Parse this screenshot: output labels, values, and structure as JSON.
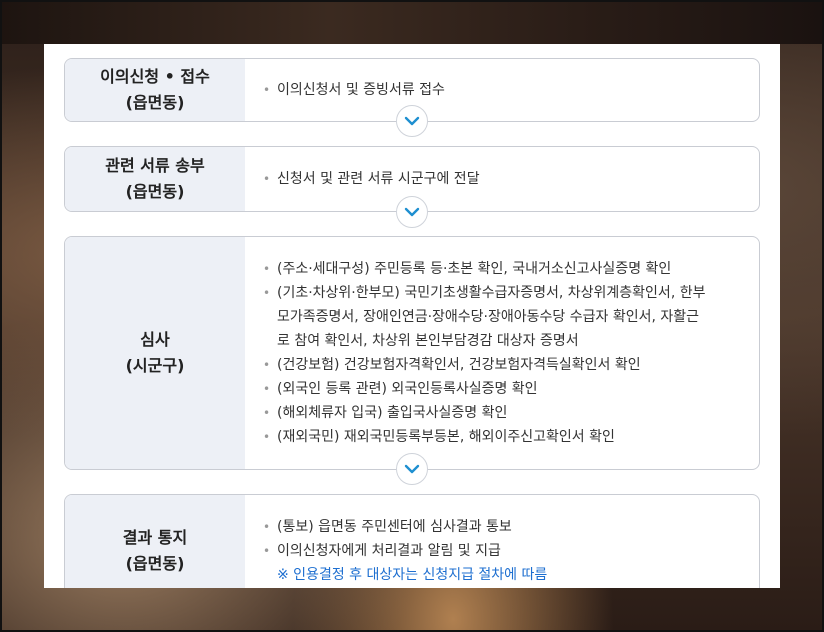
{
  "steps": [
    {
      "title_line1": "이의신청 • 접수",
      "title_line2": "(읍면동)",
      "items": [
        "이의신청서 및 증빙서류 접수"
      ]
    },
    {
      "title_line1": "관련 서류 송부",
      "title_line2": "(읍면동)",
      "items": [
        "신청서 및 관련 서류 시군구에 전달"
      ]
    },
    {
      "title_line1": "심사",
      "title_line2": "(시군구)",
      "items": [
        "(주소·세대구성) 주민등록 등·초본 확인, 국내거소신고사실증명 확인",
        "(기초·차상위·한부모) 국민기초생활수급자증명서, 차상위계층확인서, 한부",
        "모가족증명서, 장애인연금·장애수당·장애아동수당 수급자 확인서, 자활근",
        "로 참여 확인서, 차상위 본인부담경감 대상자 증명서",
        "(건강보험) 건강보험자격확인서, 건강보험자격득실확인서 확인",
        "(외국인 등록 관련) 외국인등록사실증명 확인",
        "(해외체류자 입국) 출입국사실증명 확인",
        "(재외국민) 재외국민등록부등본, 해외이주신고확인서 확인"
      ]
    },
    {
      "title_line1": "결과 통지",
      "title_line2": "(읍면동)",
      "items": [
        "(통보) 읍면동 주민센터에 심사결과 통보",
        "이의신청자에게 처리결과 알림 및 지급"
      ],
      "note": "※ 인용결정 후 대상자는 신청지급 절차에 따름"
    }
  ],
  "icons": {
    "next_step": "chevron-down-icon"
  },
  "colors": {
    "head_bg": "#edf0f6",
    "chevron": "#1e8fd0",
    "note": "#1e6fd0"
  }
}
